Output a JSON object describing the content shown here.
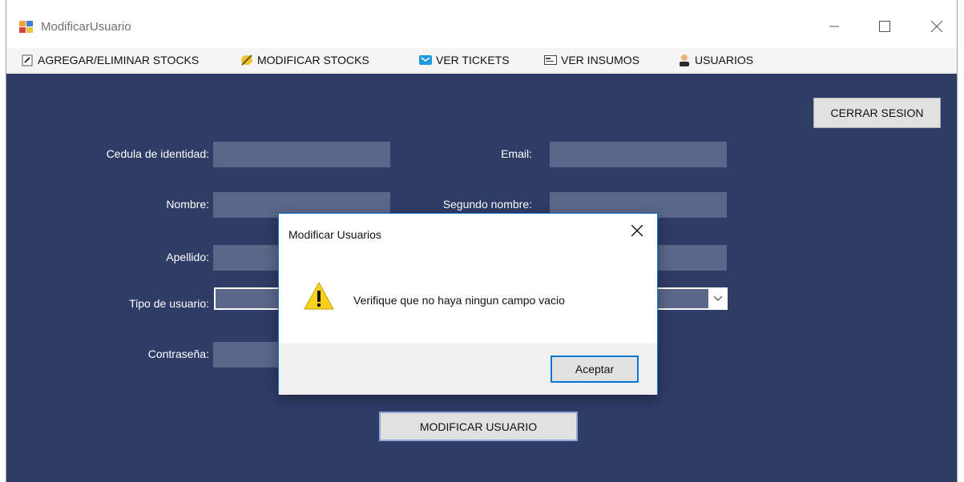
{
  "window": {
    "title": "ModificarUsuario",
    "minimize_icon": "minimize-icon",
    "maximize_icon": "maximize-icon",
    "close_icon": "close-icon"
  },
  "menu": {
    "items": [
      {
        "label": "AGREGAR/ELIMINAR STOCKS",
        "icon": "clipboard-icon"
      },
      {
        "label": "MODIFICAR STOCKS",
        "icon": "pencil-icon"
      },
      {
        "label": "VER TICKETS",
        "icon": "envelope-icon"
      },
      {
        "label": "VER INSUMOS",
        "icon": "card-icon"
      },
      {
        "label": "USUARIOS",
        "icon": "user-icon"
      }
    ]
  },
  "form": {
    "cedula_label": "Cedula de identidad:",
    "email_label": "Email:",
    "nombre_label": "Nombre:",
    "segundo_nombre_label": "Segundo nombre:",
    "apellido_label": "Apellido:",
    "tipo_usuario_label": "Tipo de usuario:",
    "contrasena_label": "Contraseña:",
    "cerrar_sesion": "CERRAR SESION",
    "modificar_usuario": "MODIFICAR USUARIO"
  },
  "dialog": {
    "title": "Modificar Usuarios",
    "message": "Verifique que no haya ningun campo vacio",
    "ok_label": "Aceptar",
    "icon": "warning-icon"
  },
  "colors": {
    "background": "#2f3c66",
    "field": "#5b6789",
    "accent": "#0078d7"
  }
}
